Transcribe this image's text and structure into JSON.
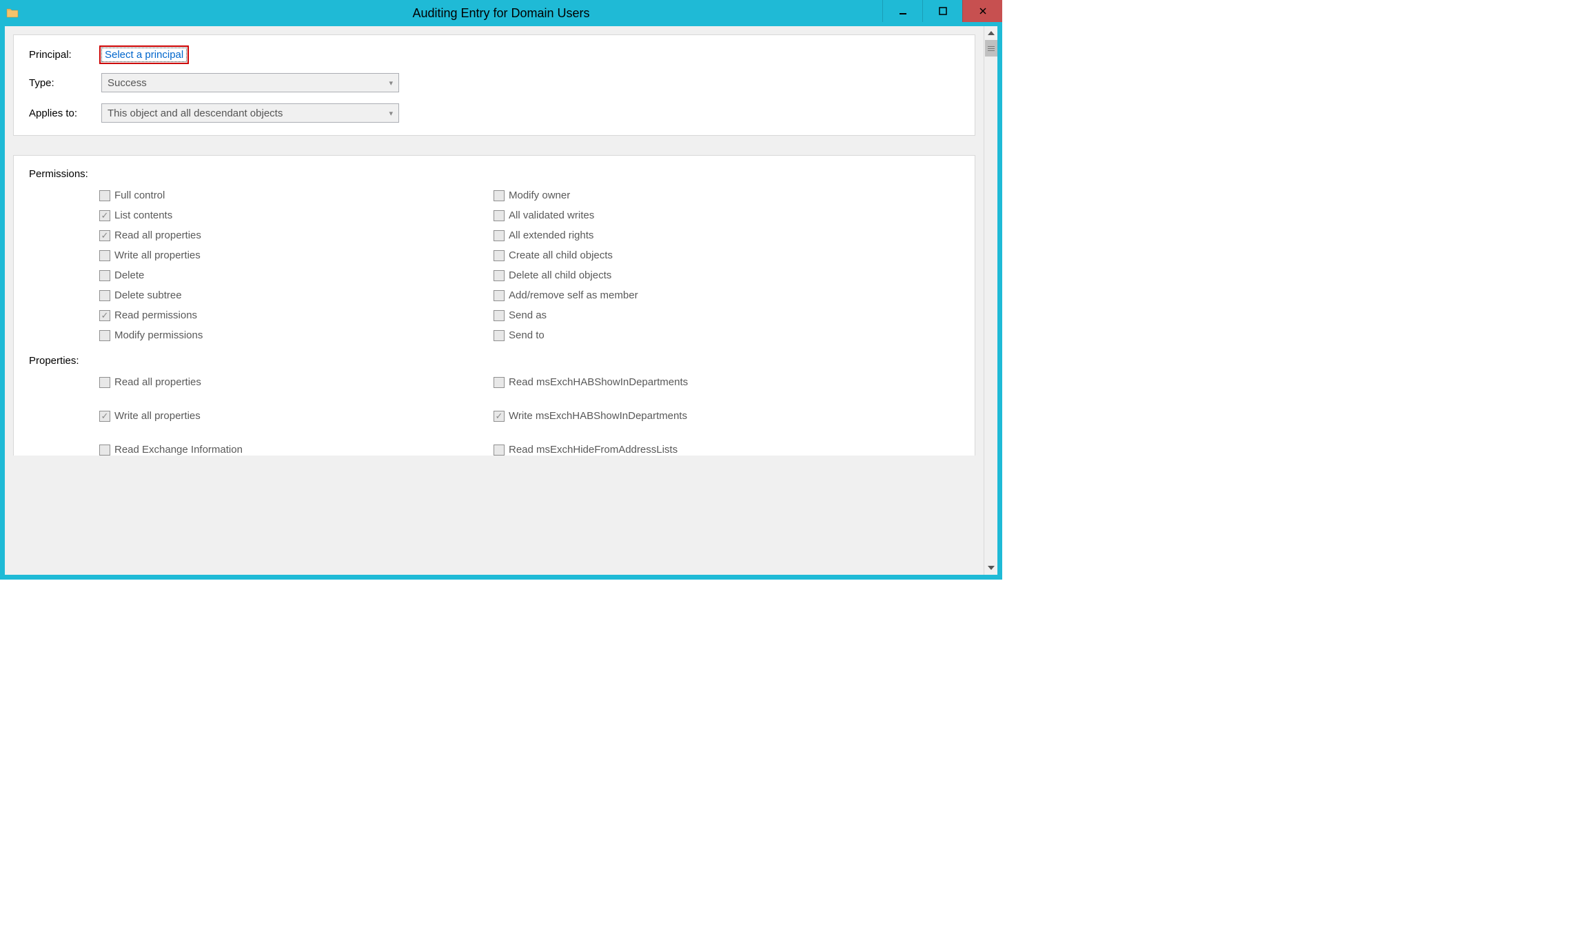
{
  "window": {
    "title": "Auditing Entry for Domain Users"
  },
  "header": {
    "principal_label": "Principal:",
    "principal_link": "Select a principal",
    "type_label": "Type:",
    "type_value": "Success",
    "applies_label": "Applies to:",
    "applies_value": "This object and all descendant objects"
  },
  "permissions": {
    "heading": "Permissions:",
    "left": [
      {
        "label": "Full control",
        "checked": false
      },
      {
        "label": "List contents",
        "checked": true
      },
      {
        "label": "Read all properties",
        "checked": true
      },
      {
        "label": "Write all properties",
        "checked": false
      },
      {
        "label": "Delete",
        "checked": false
      },
      {
        "label": "Delete subtree",
        "checked": false
      },
      {
        "label": "Read permissions",
        "checked": true
      },
      {
        "label": "Modify permissions",
        "checked": false
      }
    ],
    "right": [
      {
        "label": "Modify owner",
        "checked": false
      },
      {
        "label": "All validated writes",
        "checked": false
      },
      {
        "label": "All extended rights",
        "checked": false
      },
      {
        "label": "Create all child objects",
        "checked": false
      },
      {
        "label": "Delete all child objects",
        "checked": false
      },
      {
        "label": "Add/remove self as member",
        "checked": false
      },
      {
        "label": "Send as",
        "checked": false
      },
      {
        "label": "Send to",
        "checked": false
      }
    ]
  },
  "properties": {
    "heading": "Properties:",
    "left": [
      {
        "label": "Read all properties",
        "checked": false
      },
      {
        "label": "Write all properties",
        "checked": true
      },
      {
        "label": "Read Exchange Information",
        "checked": false
      }
    ],
    "right": [
      {
        "label": "Read msExchHABShowInDepartments",
        "checked": false
      },
      {
        "label": "Write msExchHABShowInDepartments",
        "checked": true
      },
      {
        "label": "Read msExchHideFromAddressLists",
        "checked": false
      }
    ]
  }
}
